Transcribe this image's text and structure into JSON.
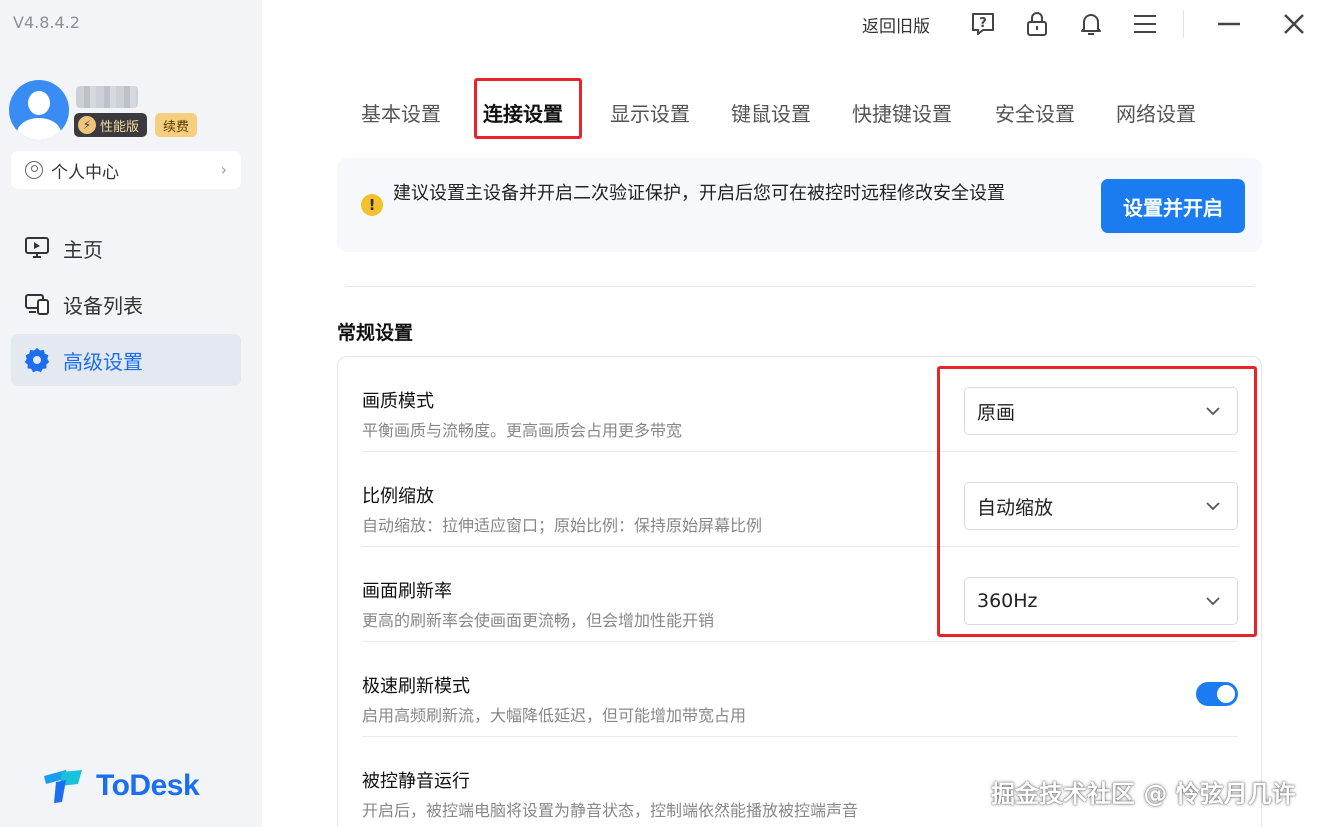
{
  "app": {
    "version": "V4.8.4.2",
    "logo_text": "ToDesk",
    "brand_color": "#1a6ff0"
  },
  "user": {
    "badge_perf": "性能版",
    "badge_renew": "续费",
    "personal_center": "个人中心"
  },
  "sidebar": {
    "items": [
      {
        "label": "主页",
        "icon": "monitor-icon"
      },
      {
        "label": "设备列表",
        "icon": "devices-icon"
      },
      {
        "label": "高级设置",
        "icon": "gear-icon",
        "active": true
      }
    ]
  },
  "topbar": {
    "back_to_old": "返回旧版",
    "icons": [
      "help-icon",
      "lock-icon",
      "bell-icon",
      "menu-icon",
      "minimize-icon",
      "close-icon"
    ]
  },
  "tabs": [
    {
      "label": "基本设置"
    },
    {
      "label": "连接设置",
      "active": true
    },
    {
      "label": "显示设置"
    },
    {
      "label": "键鼠设置"
    },
    {
      "label": "快捷键设置"
    },
    {
      "label": "安全设置"
    },
    {
      "label": "网络设置"
    }
  ],
  "notice": {
    "text": "建议设置主设备并开启二次验证保护，开启后您可在被控时远程修改安全设置",
    "button": "设置并开启"
  },
  "section": {
    "title": "常规设置"
  },
  "settings": [
    {
      "label": "画质模式",
      "desc": "平衡画质与流畅度。更高画质会占用更多带宽",
      "value": "原画",
      "control": "select"
    },
    {
      "label": "比例缩放",
      "desc": "自动缩放：拉伸适应窗口；原始比例：保持原始屏幕比例",
      "value": "自动缩放",
      "control": "select"
    },
    {
      "label": "画面刷新率",
      "desc": "更高的刷新率会使画面更流畅，但会增加性能开销",
      "value": "360Hz",
      "control": "select"
    },
    {
      "label": "极速刷新模式",
      "desc": "启用高频刷新流，大幅降低延迟，但可能增加带宽占用",
      "control": "toggle",
      "toggle_on": true
    },
    {
      "label": "被控静音运行",
      "desc": "开启后，被控端电脑将设置为静音状态，控制端依然能播放被控端声音",
      "control": "toggle"
    }
  ],
  "watermark": "掘金技术社区 @ 怜弦月几许"
}
